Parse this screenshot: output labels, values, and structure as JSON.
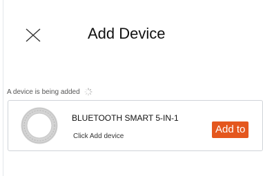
{
  "header": {
    "title": "Add Device",
    "close_icon": "close-icon"
  },
  "status": {
    "text": "A device is being added",
    "icon": "loading-spinner-icon"
  },
  "device": {
    "name": "BLUETOOTH SMART 5-IN-1",
    "hint": "Click Add device",
    "add_label": "Add to",
    "avatar_icon": "device-ring-icon"
  },
  "colors": {
    "accent": "#e4571e",
    "border": "#cfd3d8",
    "text": "#111111"
  }
}
